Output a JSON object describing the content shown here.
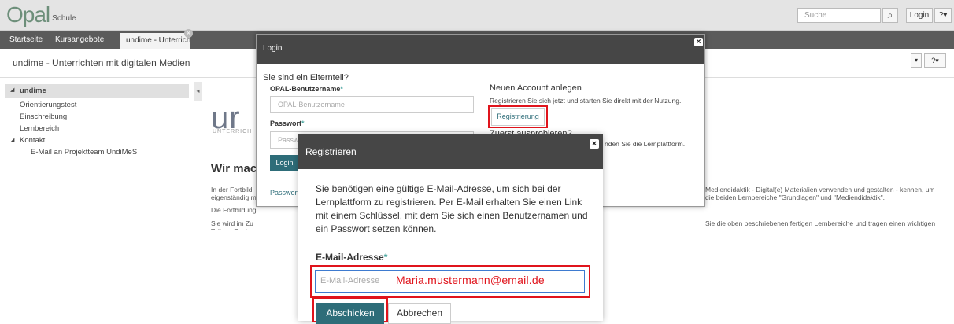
{
  "header": {
    "logo_text": "Opal",
    "logo_sub": "Schule",
    "search_placeholder": "Suche",
    "search_icon": "search-icon",
    "login_label": "Login",
    "help_label": "?▾"
  },
  "nav": {
    "tabs": [
      "Startseite",
      "Kursangebote"
    ],
    "active_tab": "undime - Unterrichten ...",
    "close_icon": "×"
  },
  "course": {
    "title": "undime - Unterrichten mit digitalen Medien",
    "dropdown_label": "▾",
    "help_label": "?▾"
  },
  "sidebar": {
    "root": "undime",
    "items": [
      "Orientierungstest",
      "Einschreibung",
      "Lernbereich"
    ],
    "group": "Kontakt",
    "sub_items": [
      "E-Mail an Projektteam UndiMeS"
    ],
    "expanded_icon": "◢",
    "collapse_handle": "◂"
  },
  "background": {
    "logo_text": "ur",
    "logo_sub": "UNTERRICH",
    "heading": "Wir mach",
    "lines_left": [
      "In der Fortbild",
      "eigenständig m",
      "Die Fortbildung",
      "Sie wird im Zu",
      "Teil zur Evalua"
    ],
    "lines_right": [
      "Mediendidaktik - Digital(e) Materialien verwenden und gestalten - kennen, um",
      "die beiden Lernbereiche \"Grundlagen\" und \"Mediendidaktik\".",
      "Sie die oben beschriebenen fertigen Lernbereiche und tragen einen wichtigen"
    ]
  },
  "login_modal": {
    "title": "Login",
    "close_icon": "×",
    "parent_question": "Sie sind ein Elternteil?",
    "username_label": "OPAL-Benutzername",
    "username_placeholder": "OPAL-Benutzername",
    "password_label": "Passwort",
    "password_placeholder": "Passwort",
    "required_mark": "*",
    "login_button": "Login",
    "forgot_link": "Passwort",
    "new_account_heading": "Neuen Account anlegen",
    "new_account_text": "Registrieren Sie sich jetzt und starten Sie direkt mit der Nutzung.",
    "register_button": "Registrierung",
    "try_heading": "Zuerst ausprobieren?",
    "try_text": "nden Sie die Lernplattform."
  },
  "register_modal": {
    "title": "Registrieren",
    "close_icon": "×",
    "info": "Sie benötigen eine gültige E-Mail-Adresse, um sich bei der Lernplattform zu registrieren. Per E-Mail erhalten Sie einen Link mit einem Schlüssel, mit dem Sie sich einen Benutzernamen und ein Passwort setzen können.",
    "email_label": "E-Mail-Adresse",
    "required_mark": "*",
    "email_placeholder": "E-Mail-Adresse",
    "email_typed": "Maria.mustermann@email.de",
    "submit_button": "Abschicken",
    "cancel_button": "Abbrechen"
  },
  "colors": {
    "accent": "#2e6d79",
    "highlight": "#e0141c",
    "modal_header": "#464646"
  }
}
